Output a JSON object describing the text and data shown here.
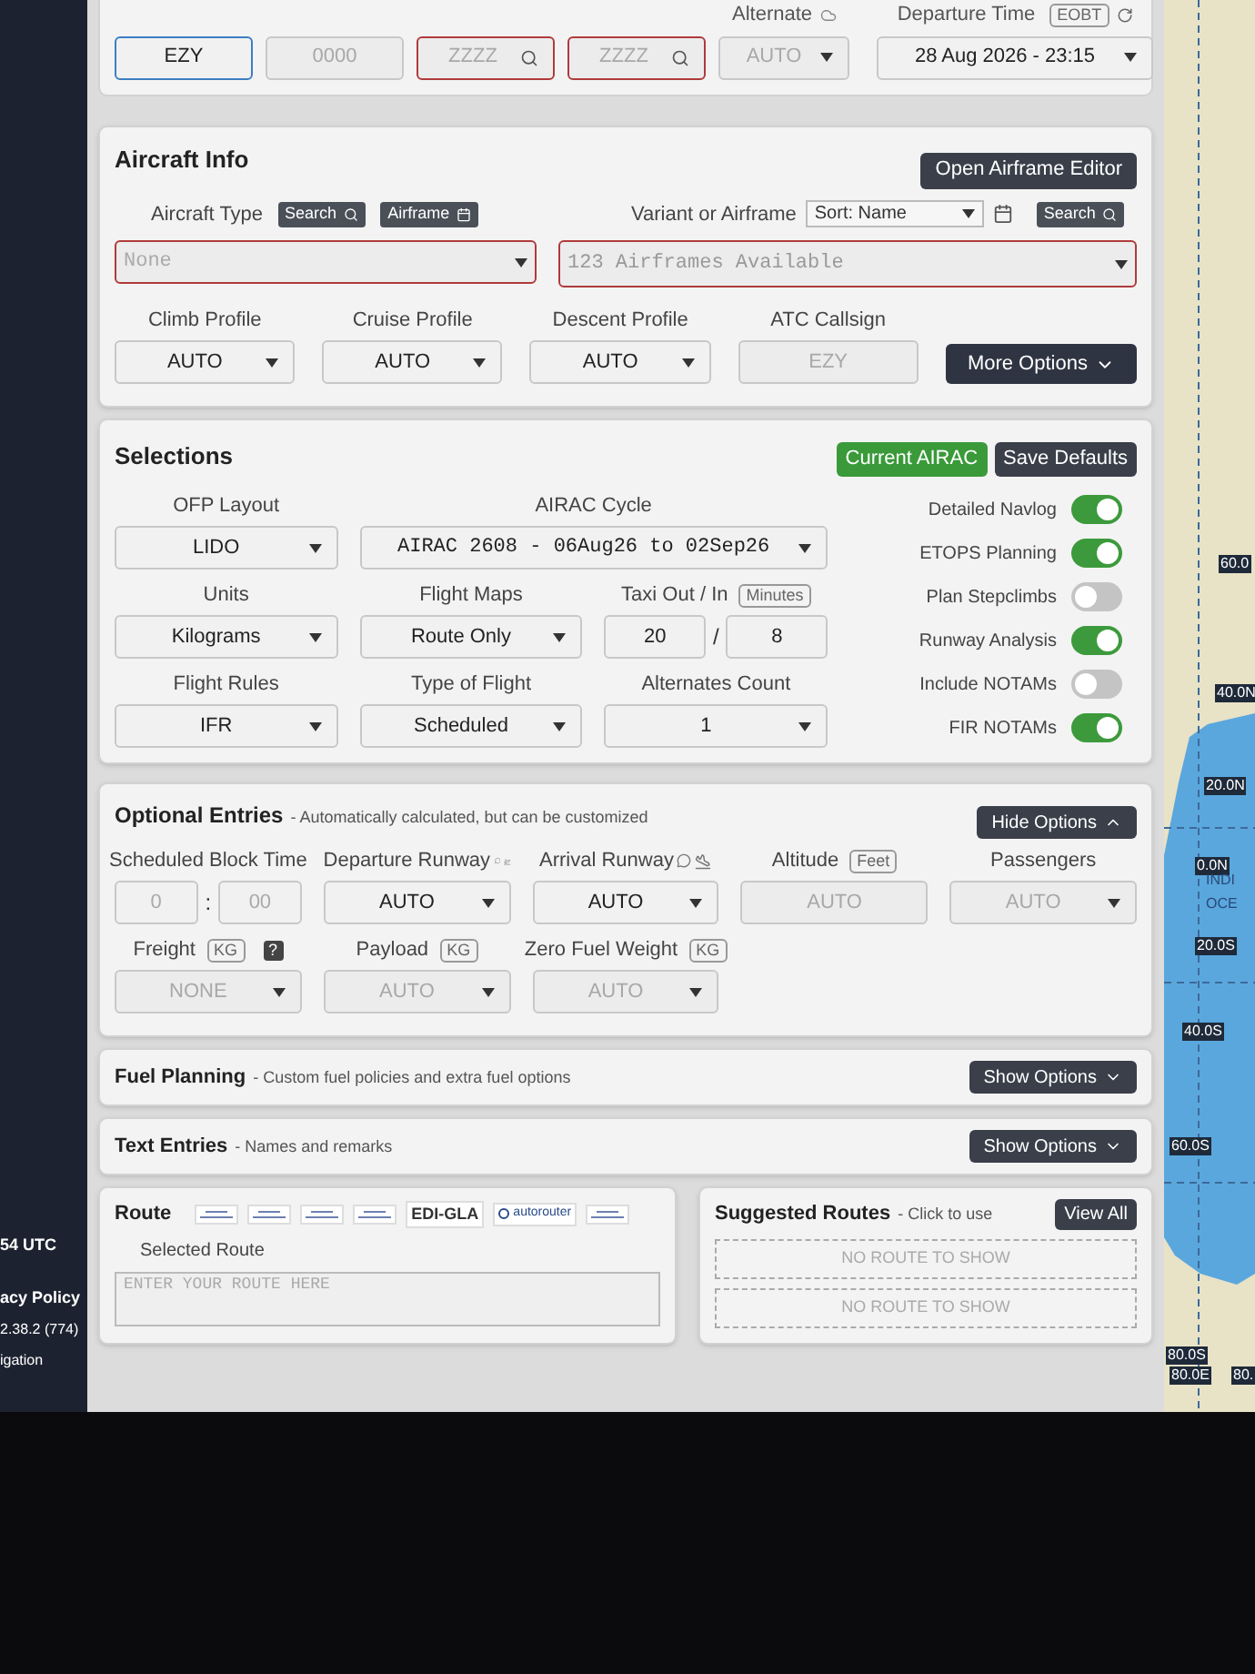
{
  "header_fields": [
    {
      "kind": "input",
      "value": "EZY",
      "focused": true,
      "invalid": false
    },
    {
      "kind": "input",
      "placeholder": "0000",
      "focused": false,
      "invalid": false
    },
    {
      "kind": "search",
      "placeholder": "ZZZZ",
      "focused": false,
      "invalid": true
    },
    {
      "kind": "search",
      "placeholder": "ZZZZ",
      "focused": false,
      "invalid": true
    },
    {
      "kind": "select",
      "label": "Alternate",
      "placeholder": "AUTO",
      "focused": false,
      "invalid": false
    },
    {
      "kind": "select",
      "label": "Departure Time",
      "badge": "EOBT",
      "value": "28 Aug 2026 - 23:15",
      "focused": false,
      "invalid": false
    }
  ],
  "aircraft_info": {
    "title": "Aircraft Info",
    "editor_button": "Open Airframe Editor",
    "type_label": "Aircraft Type",
    "type_buttons": [
      {
        "label": "Search",
        "kind": "search"
      },
      {
        "label": "Airframe",
        "kind": "calendar"
      }
    ],
    "type_select": {
      "placeholder": "None",
      "invalid": true
    },
    "variant_label": "Variant or Airframe",
    "sort_select": "Sort: Name",
    "variant_search": "Search",
    "airframe_select": {
      "placeholder": "123 Airframes Available",
      "invalid": true
    },
    "profiles": [
      {
        "label": "Climb Profile",
        "kind": "select",
        "value": "AUTO"
      },
      {
        "label": "Cruise Profile",
        "kind": "select",
        "value": "AUTO"
      },
      {
        "label": "Descent Profile",
        "kind": "select",
        "value": "AUTO"
      },
      {
        "label": "ATC Callsign",
        "kind": "input",
        "placeholder": "EZY"
      }
    ],
    "more_button": "More Options"
  },
  "selections": {
    "title": "Selections",
    "buttons": [
      {
        "label": "Current AIRAC",
        "kind": "primary"
      },
      {
        "label": "Save Defaults",
        "kind": "dark"
      }
    ],
    "fields": [
      {
        "label": "OFP Layout",
        "kind": "select",
        "value": "LIDO"
      },
      {
        "label": "AIRAC Cycle",
        "kind": "wide",
        "value": "AIRAC 2608 - 06Aug26 to 02Sep26"
      },
      {
        "label": "Units",
        "kind": "select",
        "value": "Kilograms"
      },
      {
        "label": "Flight Maps",
        "kind": "select",
        "value": "Route Only"
      },
      {
        "label": "Taxi Out / In",
        "badge": "Minutes",
        "kind": "pair",
        "values": [
          "20",
          "8"
        ],
        "separator": "/"
      },
      {
        "label": "Flight Rules",
        "kind": "select",
        "value": "IFR"
      },
      {
        "label": "Type of Flight",
        "kind": "select",
        "value": "Scheduled"
      },
      {
        "label": "Alternates Count",
        "kind": "select",
        "value": "1"
      }
    ],
    "toggles": [
      {
        "label": "Detailed Navlog",
        "on": true
      },
      {
        "label": "ETOPS Planning",
        "on": true
      },
      {
        "label": "Plan Stepclimbs",
        "on": false
      },
      {
        "label": "Runway Analysis",
        "on": true
      },
      {
        "label": "Include NOTAMs",
        "on": false
      },
      {
        "label": "FIR NOTAMs",
        "on": true
      }
    ]
  },
  "optional_entries": {
    "title": "Optional Entries",
    "subtitle": "- Automatically calculated, but can be customized",
    "button": "Hide Options",
    "expanded": true,
    "fields": [
      {
        "label": "Scheduled Block Time",
        "kind": "pair",
        "placeholders": [
          "0",
          "00"
        ],
        "separator": ":"
      },
      {
        "label": "Departure Runway",
        "kind": "departure_runway",
        "value": "AUTO"
      },
      {
        "label": "Arrival Runway",
        "kind": "arrival_runway",
        "value": "AUTO"
      },
      {
        "label": "Altitude",
        "badge": "Feet",
        "kind": "input",
        "placeholder": "AUTO"
      },
      {
        "label": "Passengers",
        "kind": "select",
        "placeholder": "AUTO"
      },
      {
        "label": "Freight",
        "badge": "KG",
        "help": "?",
        "kind": "select",
        "placeholder": "NONE"
      },
      {
        "label": "Payload",
        "badge": "KG",
        "kind": "select",
        "placeholder": "AUTO"
      },
      {
        "label": "Zero Fuel Weight",
        "badge": "KG",
        "kind": "select",
        "placeholder": "AUTO"
      }
    ]
  },
  "collapsed_sections": [
    {
      "title": "Fuel Planning",
      "subtitle": "- Custom fuel policies and extra fuel options",
      "button": "Show Options",
      "expanded": false
    },
    {
      "title": "Text Entries",
      "subtitle": "- Names and remarks",
      "button": "Show Options",
      "expanded": false
    }
  ],
  "route": {
    "title": "Route",
    "providers": [
      {
        "kind": "logo"
      },
      {
        "kind": "logo"
      },
      {
        "kind": "logo"
      },
      {
        "kind": "logo"
      },
      {
        "kind": "text",
        "label": "EDI-GLA"
      },
      {
        "kind": "icon_text",
        "label": "autorouter"
      },
      {
        "kind": "logo"
      }
    ],
    "selected_label": "Selected Route",
    "placeholder": "ENTER YOUR ROUTE HERE"
  },
  "suggested_routes": {
    "title": "Suggested Routes",
    "subtitle": "- Click to use",
    "button": "View All",
    "empty_boxes": [
      "NO ROUTE TO SHOW",
      "NO ROUTE TO SHOW"
    ]
  },
  "sidebar": [
    {
      "kind": "bold",
      "text": "54 UTC"
    },
    {
      "kind": "bold",
      "text": "acy Policy"
    },
    {
      "kind": "small",
      "text": "2.38.2 (774)"
    },
    {
      "kind": "small",
      "text": "igation"
    }
  ],
  "map": {
    "labels": [
      {
        "kind": "tag",
        "text": "60.0"
      },
      {
        "kind": "tag",
        "text": "40.0N"
      },
      {
        "kind": "tag",
        "text": "20.0N"
      },
      {
        "kind": "tag",
        "text": "0.0N"
      },
      {
        "kind": "plain",
        "text": "INDI"
      },
      {
        "kind": "plain",
        "text": "OCE"
      },
      {
        "kind": "tag",
        "text": "20.0S"
      },
      {
        "kind": "tag",
        "text": "40.0S"
      },
      {
        "kind": "tag",
        "text": "60.0S"
      },
      {
        "kind": "tag",
        "text": "80.0S"
      },
      {
        "kind": "tag",
        "text": "80.0E"
      },
      {
        "kind": "tag",
        "text": "80."
      }
    ]
  }
}
